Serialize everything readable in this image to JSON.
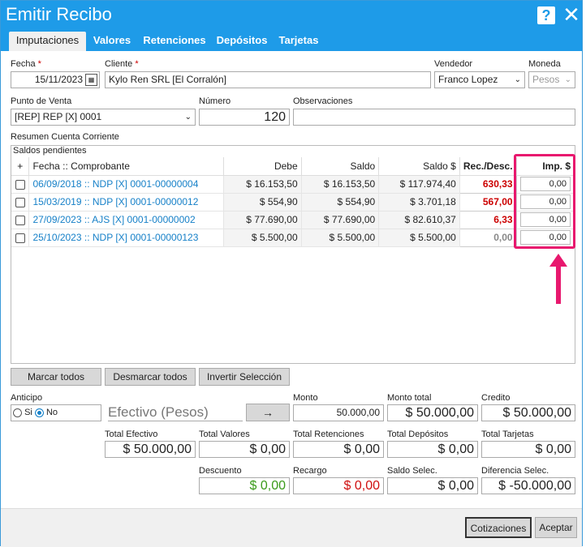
{
  "window": {
    "title": "Emitir Recibo",
    "help": "?",
    "close": "✕"
  },
  "tabs": [
    "Imputaciones",
    "Valores",
    "Retenciones",
    "Depósitos",
    "Tarjetas"
  ],
  "header": {
    "fecha_label": "Fecha",
    "fecha_value": "15/11/2023",
    "cliente_label": "Cliente",
    "cliente_value": "Kylo Ren SRL [El Corralón]",
    "vendedor_label": "Vendedor",
    "vendedor_value": "Franco Lopez",
    "moneda_label": "Moneda",
    "moneda_value": "Pesos",
    "pv_label": "Punto de Venta",
    "pv_value": "[REP] REP [X] 0001",
    "numero_label": "Número",
    "numero_value": "120",
    "obs_label": "Observaciones",
    "obs_value": "",
    "required_mark": "*"
  },
  "grid": {
    "section_label": "Resumen Cuenta Corriente",
    "group_label": "Saldos pendientes",
    "columns": [
      "+",
      "Fecha :: Comprobante",
      "Debe",
      "Saldo",
      "Saldo $",
      "Rec./Desc.",
      "Imp. $"
    ],
    "rows": [
      {
        "comprobante": "06/09/2018 :: NDP [X] 0001-00000004",
        "debe": "$ 16.153,50",
        "saldo": "$ 16.153,50",
        "saldo_pesos": "$ 117.974,40",
        "rec": "630,33",
        "imp": "0,00"
      },
      {
        "comprobante": "15/03/2019 :: NDP [X] 0001-00000012",
        "debe": "$ 554,90",
        "saldo": "$ 554,90",
        "saldo_pesos": "$ 3.701,18",
        "rec": "567,00",
        "imp": "0,00"
      },
      {
        "comprobante": "27/09/2023 :: AJS [X] 0001-00000002",
        "debe": "$ 77.690,00",
        "saldo": "$ 77.690,00",
        "saldo_pesos": "$ 82.610,37",
        "rec": "6,33",
        "imp": "0,00"
      },
      {
        "comprobante": "25/10/2023 :: NDP [X] 0001-00000123",
        "debe": "$ 5.500,00",
        "saldo": "$ 5.500,00",
        "saldo_pesos": "$ 5.500,00",
        "rec": "0,00",
        "imp": "0,00"
      }
    ]
  },
  "actions": {
    "marcar": "Marcar todos",
    "desmarcar": "Desmarcar todos",
    "invertir": "Invertir Selección"
  },
  "anticipo": {
    "label": "Anticipo",
    "si": "Si",
    "no": "No",
    "efectivo": "Efectivo (Pesos)",
    "arrow": "→"
  },
  "totals": {
    "monto_label": "Monto",
    "monto_value": "50.000,00",
    "monto_total_label": "Monto total",
    "monto_total_value": "$ 50.000,00",
    "credito_label": "Credito",
    "credito_value": "$ 50.000,00",
    "efectivo_label": "Total Efectivo",
    "efectivo_value": "$ 50.000,00",
    "valores_label": "Total Valores",
    "valores_value": "$ 0,00",
    "retenciones_label": "Total Retenciones",
    "retenciones_value": "$ 0,00",
    "depositos_label": "Total Depósitos",
    "depositos_value": "$ 0,00",
    "tarjetas_label": "Total Tarjetas",
    "tarjetas_value": "$ 0,00",
    "descuento_label": "Descuento",
    "descuento_value": "$ 0,00",
    "recargo_label": "Recargo",
    "recargo_value": "$ 0,00",
    "saldo_sel_label": "Saldo Selec.",
    "saldo_sel_value": "$ 0,00",
    "dif_label": "Diferencia Selec.",
    "dif_value": "$ -50.000,00"
  },
  "footer": {
    "cotizaciones": "Cotizaciones",
    "aceptar": "Aceptar"
  },
  "colors": {
    "accent": "#1e9be8",
    "highlight": "#e8186e",
    "negative": "#d01010",
    "positive": "#3a9a1a"
  }
}
